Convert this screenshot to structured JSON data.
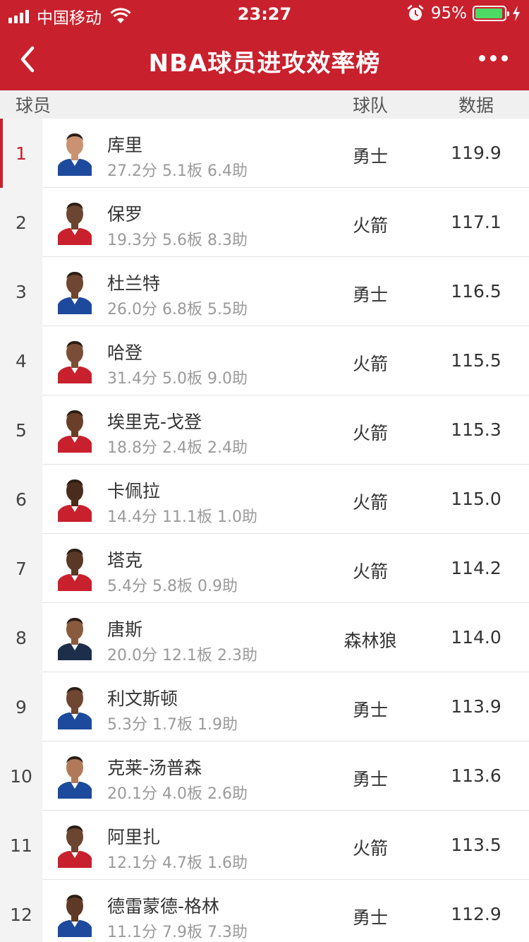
{
  "status_bar": {
    "carrier": "中国移动",
    "time": "23:27",
    "battery_percent": "95%",
    "battery_level": 0.95,
    "icons": [
      "signal-icon",
      "wifi-icon",
      "alarm-icon",
      "battery-icon",
      "charging-icon"
    ]
  },
  "nav": {
    "title": "NBA球员进攻效率榜",
    "back_icon": "chevron-left-icon",
    "more_icon": "more-dots-icon"
  },
  "table_header": {
    "player": "球员",
    "team": "球队",
    "data": "数据"
  },
  "colors": {
    "brand_red": "#c9202d",
    "warriors": "#1d4a9c",
    "rockets": "#c9202d",
    "timberwolves": "#1c2e4a"
  },
  "rows": [
    {
      "rank": "1",
      "name": "库里",
      "stats": "27.2分 5.1板 6.4助",
      "team": "勇士",
      "value": "119.9",
      "jersey": "#1d4a9c",
      "skin": "#c99270"
    },
    {
      "rank": "2",
      "name": "保罗",
      "stats": "19.3分 5.6板 8.3助",
      "team": "火箭",
      "value": "117.1",
      "jersey": "#c9202d",
      "skin": "#6b4530"
    },
    {
      "rank": "3",
      "name": "杜兰特",
      "stats": "26.0分 6.8板 5.5助",
      "team": "勇士",
      "value": "116.5",
      "jersey": "#1d4a9c",
      "skin": "#6e4631"
    },
    {
      "rank": "4",
      "name": "哈登",
      "stats": "31.4分 5.0板 9.0助",
      "team": "火箭",
      "value": "115.5",
      "jersey": "#c9202d",
      "skin": "#7a4e36"
    },
    {
      "rank": "5",
      "name": "埃里克-戈登",
      "stats": "18.8分 2.4板 2.4助",
      "team": "火箭",
      "value": "115.3",
      "jersey": "#c9202d",
      "skin": "#6a3f28"
    },
    {
      "rank": "6",
      "name": "卡佩拉",
      "stats": "14.4分 11.1板 1.0助",
      "team": "火箭",
      "value": "115.0",
      "jersey": "#c9202d",
      "skin": "#4a2c1c"
    },
    {
      "rank": "7",
      "name": "塔克",
      "stats": "5.4分 5.8板 0.9助",
      "team": "火箭",
      "value": "114.2",
      "jersey": "#c9202d",
      "skin": "#5a3826"
    },
    {
      "rank": "8",
      "name": "唐斯",
      "stats": "20.0分 12.1板 2.3助",
      "team": "森林狼",
      "value": "114.0",
      "jersey": "#1c2e4a",
      "skin": "#8a5a3e"
    },
    {
      "rank": "9",
      "name": "利文斯顿",
      "stats": "5.3分 1.7板 1.9助",
      "team": "勇士",
      "value": "113.9",
      "jersey": "#1d4a9c",
      "skin": "#6e4631"
    },
    {
      "rank": "10",
      "name": "克莱-汤普森",
      "stats": "20.1分 4.0板 2.6助",
      "team": "勇士",
      "value": "113.6",
      "jersey": "#1d4a9c",
      "skin": "#b07a58"
    },
    {
      "rank": "11",
      "name": "阿里扎",
      "stats": "12.1分 4.7板 1.6助",
      "team": "火箭",
      "value": "113.5",
      "jersey": "#c9202d",
      "skin": "#6b4530"
    },
    {
      "rank": "12",
      "name": "德雷蒙德-格林",
      "stats": "11.1分 7.9板 7.3助",
      "team": "勇士",
      "value": "112.9",
      "jersey": "#1d4a9c",
      "skin": "#5e3a26"
    }
  ]
}
